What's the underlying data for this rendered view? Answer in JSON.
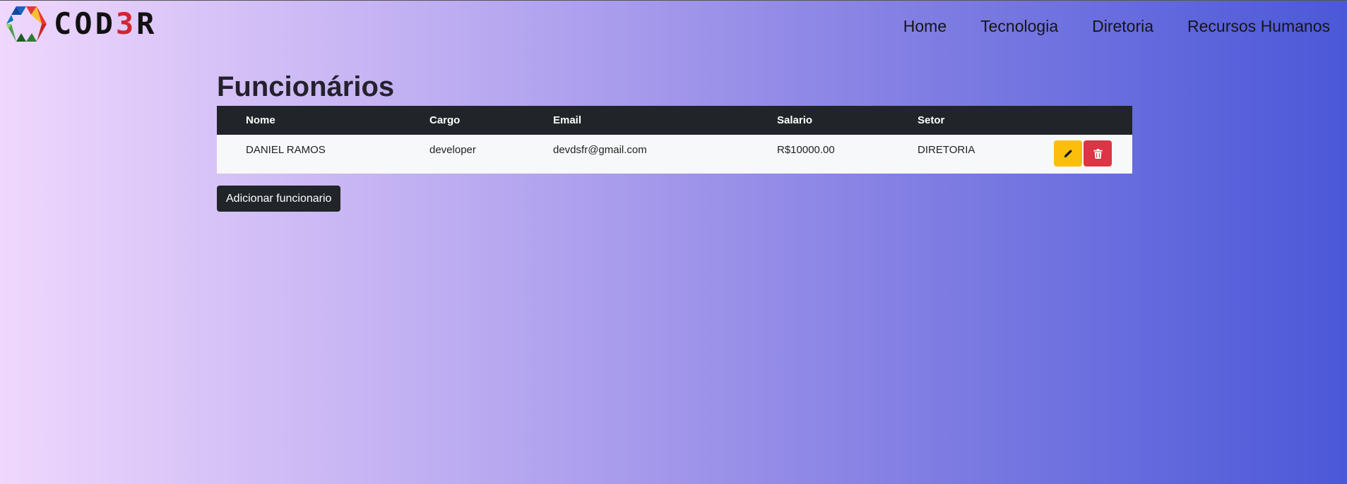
{
  "brand": {
    "logo_name": "hexagon-logo-icon",
    "text_prefix": "COD",
    "text_highlight": "3",
    "text_suffix": "R"
  },
  "nav": {
    "items": [
      {
        "label": "Home"
      },
      {
        "label": "Tecnologia"
      },
      {
        "label": "Diretoria"
      },
      {
        "label": "Recursos Humanos"
      }
    ]
  },
  "main": {
    "title": "Funcionários",
    "table": {
      "headers": [
        "Nome",
        "Cargo",
        "Email",
        "Salario",
        "Setor"
      ],
      "rows": [
        {
          "nome": "DANIEL RAMOS",
          "cargo": "developer",
          "email": "devdsfr@gmail.com",
          "salario": "R$10000.00",
          "setor": "DIRETORIA",
          "edit_icon": "pencil-icon",
          "delete_icon": "trash-icon"
        }
      ]
    },
    "add_button_label": "Adicionar funcionario"
  },
  "colors": {
    "gradient_start": "#efd7fd",
    "gradient_end": "#4b58d8",
    "table_header": "#212529",
    "edit_button": "#fbbf0b",
    "delete_button": "#dc3545",
    "logo_accent": "#d3242f"
  }
}
